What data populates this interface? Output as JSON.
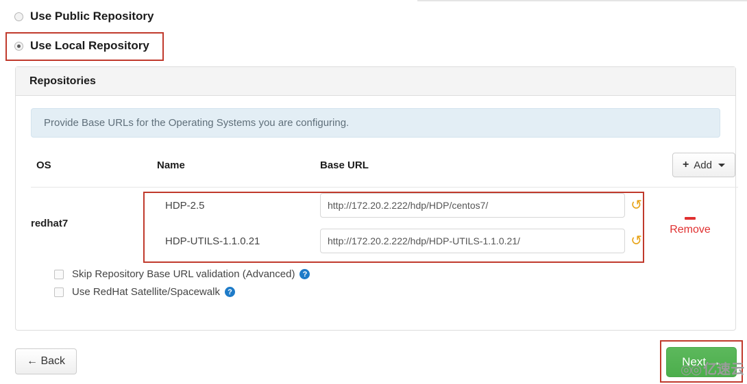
{
  "repository_source": {
    "public": {
      "label": "Use Public Repository",
      "selected": false
    },
    "local": {
      "label": "Use Local Repository",
      "selected": true
    }
  },
  "panel": {
    "title": "Repositories",
    "alert": "Provide Base URLs for the Operating Systems you are configuring.",
    "table": {
      "headers": {
        "os": "OS",
        "name": "Name",
        "url": "Base URL"
      },
      "add_button": {
        "label": "Add",
        "plus": "+"
      },
      "rows": [
        {
          "os": "redhat7",
          "repos": [
            {
              "name": "HDP-2.5",
              "url": "http://172.20.2.222/hdp/HDP/centos7/",
              "reset_icon": "undo-icon"
            },
            {
              "name": "HDP-UTILS-1.1.0.21",
              "url": "http://172.20.2.222/hdp/HDP-UTILS-1.1.0.21/",
              "reset_icon": "undo-icon"
            }
          ],
          "remove_label": "Remove"
        }
      ]
    },
    "options": [
      {
        "label": "Skip Repository Base URL validation (Advanced)",
        "checked": false,
        "help": "?"
      },
      {
        "label": "Use RedHat Satellite/Spacewalk",
        "checked": false,
        "help": "?"
      }
    ]
  },
  "footer": {
    "back_label": "← Back",
    "next_label": "Next →"
  },
  "watermark": {
    "logo": "◎◎",
    "text": "亿速云"
  },
  "colors": {
    "accent_green": "#5cb85c",
    "annotation_red": "#c0392b",
    "remove_red": "#e03030",
    "help_blue": "#1e7bc8",
    "reset_orange": "#e8a317"
  }
}
